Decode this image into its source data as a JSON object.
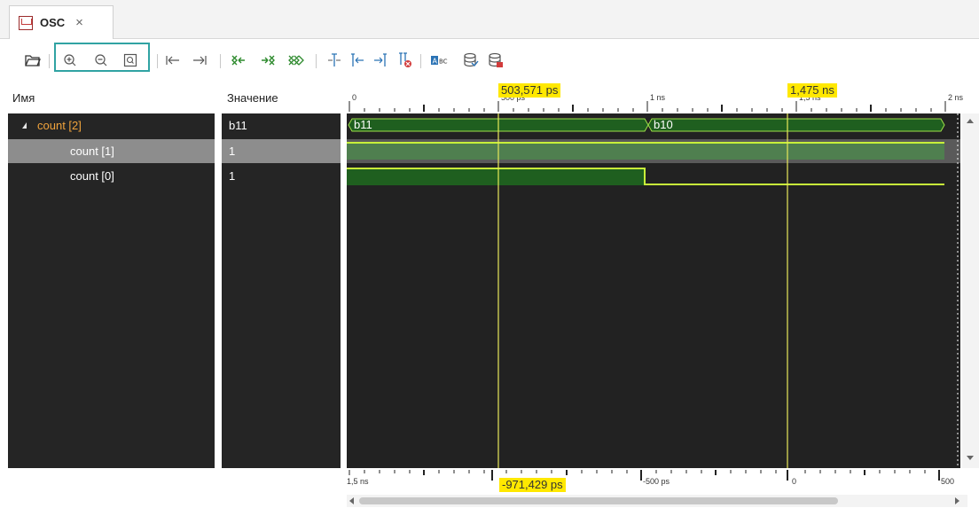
{
  "tab": {
    "title": "OSC",
    "close": "×"
  },
  "columns": {
    "name": "Имя",
    "value": "Значение"
  },
  "signals": [
    {
      "name": "count [2]",
      "value": "b11",
      "expanded": true
    },
    {
      "name": "count [1]",
      "value": "1"
    },
    {
      "name": "count [0]",
      "value": "1"
    }
  ],
  "bus": {
    "seg1": "b11",
    "seg2": "b10"
  },
  "cursors": {
    "c1": "503,571 ps",
    "c2": "1,475 ns",
    "delta": "-971,429 ps"
  },
  "ruler_top": {
    "t0": "0",
    "t1": "500 ps",
    "t2": "1 ns",
    "t3": "1,5 ns",
    "t4": "2 ns"
  },
  "ruler_bottom": {
    "b0": "1,5 ns",
    "b1": "-500 ps",
    "b2": "0",
    "b3": "500"
  },
  "toolbar": {
    "icons": [
      "open-folder-icon",
      "zoom-in-icon",
      "zoom-out-icon",
      "zoom-fit-icon",
      "go-to-start-icon",
      "go-to-end-icon",
      "prev-transition-icon",
      "next-transition-icon",
      "swap-cursors-icon",
      "add-marker-icon",
      "prev-marker-icon",
      "next-marker-icon",
      "delete-marker-icon",
      "radix-icon",
      "database-icon",
      "database-export-icon"
    ]
  },
  "colors": {
    "signal_yellow": "#c8f03a",
    "bus_fill": "#1f5f1f",
    "row_fill": "#4f7f4f",
    "cursor": "#ffe800",
    "orange": "#f0a33c"
  }
}
